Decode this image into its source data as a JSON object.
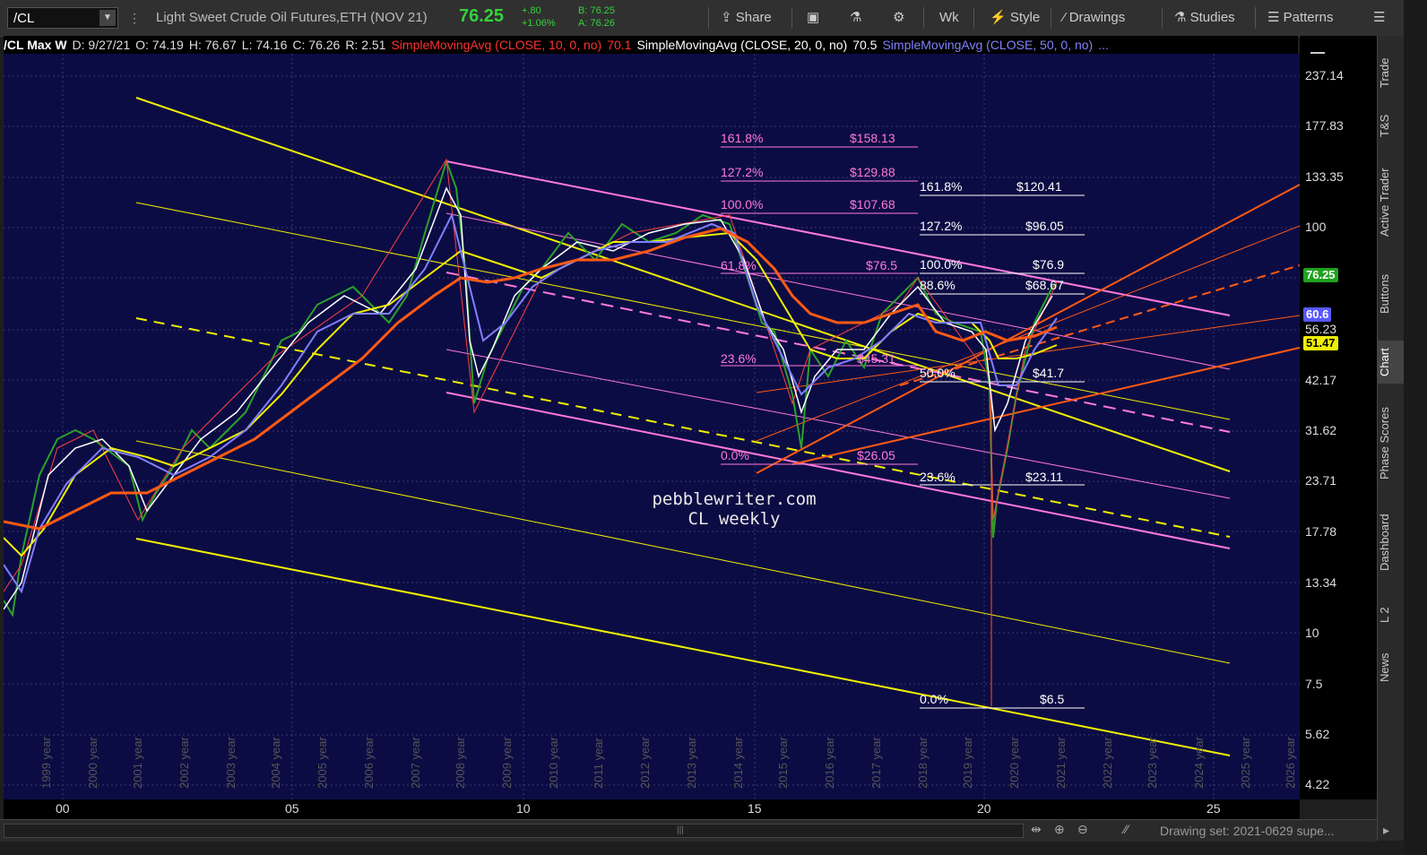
{
  "toolbar": {
    "symbol": "/CL",
    "description": "Light Sweet Crude Oil Futures,ETH (NOV 21)",
    "last": "76.25",
    "change": "+.80",
    "change_pct": "+1.06%",
    "bid": "B: 76.25",
    "ask": "A: 76.26",
    "share": "Share",
    "period": "Wk",
    "style": "Style",
    "drawings": "Drawings",
    "studies": "Studies",
    "patterns": "Patterns"
  },
  "header": {
    "symbol_period": "/CL Max W",
    "date": "D: 9/27/21",
    "open": "O: 74.19",
    "high": "H: 76.67",
    "low": "L: 74.16",
    "close": "C: 76.26",
    "range": "R: 2.51",
    "sma10": "SimpleMovingAvg (CLOSE, 10, 0, no)",
    "sma10_val": "70.1",
    "sma20": "SimpleMovingAvg (CLOSE, 20, 0, no)",
    "sma20_val": "70.5",
    "sma50": "SimpleMovingAvg (CLOSE, 50, 0, no)",
    "sma50_val": "...",
    "colors": {
      "sma10": "#ff3030",
      "sma20": "#ffffff",
      "sma50": "#8080ff"
    }
  },
  "price_axis": {
    "ticks": [
      "237.14",
      "177.83",
      "133.35",
      "100",
      "42.17",
      "31.62",
      "23.71",
      "17.78",
      "13.34",
      "10",
      "7.5",
      "5.62",
      "4.22"
    ],
    "tags": [
      {
        "label": "76.25",
        "color": "#1ea31e",
        "text": "#ffffff"
      },
      {
        "label": "60.6",
        "color": "#5858ff",
        "text": "#ffffff"
      },
      {
        "label": "56.23",
        "color": "transparent",
        "text": "#ddd"
      },
      {
        "label": "51.47",
        "color": "#f0f000",
        "text": "#000000"
      }
    ]
  },
  "time_axis": {
    "ticks": [
      "00",
      "05",
      "10",
      "15",
      "20",
      "25"
    ]
  },
  "year_labels": [
    "1999 year",
    "2000 year",
    "2001 year",
    "2002 year",
    "2003 year",
    "2004 year",
    "2005 year",
    "2006 year",
    "2007 year",
    "2008 year",
    "2009 year",
    "2010 year",
    "2011 year",
    "2012 year",
    "2013 year",
    "2014 year",
    "2015 year",
    "2016 year",
    "2017 year",
    "2018 year",
    "2019 year",
    "2020 year",
    "2021 year",
    "2022 year",
    "2023 year",
    "2024 year",
    "2025 year",
    "2026 year"
  ],
  "fib_magenta": [
    {
      "pct": "161.8%",
      "val": "$158.13"
    },
    {
      "pct": "127.2%",
      "val": "$129.88"
    },
    {
      "pct": "100.0%",
      "val": "$107.68"
    },
    {
      "pct": "61.8%",
      "val": "$76.5"
    },
    {
      "pct": "23.6%",
      "val": "$45.31"
    },
    {
      "pct": "0.0%",
      "val": "$26.05"
    }
  ],
  "fib_white": [
    {
      "pct": "161.8%",
      "val": "$120.41"
    },
    {
      "pct": "127.2%",
      "val": "$96.05"
    },
    {
      "pct": "100.0%",
      "val": "$76.9"
    },
    {
      "pct": "88.6%",
      "val": "$68.67"
    },
    {
      "pct": "50.0%",
      "val": "$41.7"
    },
    {
      "pct": "23.6%",
      "val": "$23.11"
    },
    {
      "pct": "0.0%",
      "val": "$6.5"
    }
  ],
  "watermark": {
    "line1": "pebblewriter.com",
    "line2": "CL weekly"
  },
  "bottom": {
    "drawing_set": "Drawing set: 2021-0629 supe..."
  },
  "side_tabs": [
    "Trade",
    "T&S",
    "Active Trader",
    "Buttons",
    "Chart",
    "Phase Scores",
    "Dashboard",
    "L 2",
    "News"
  ]
}
